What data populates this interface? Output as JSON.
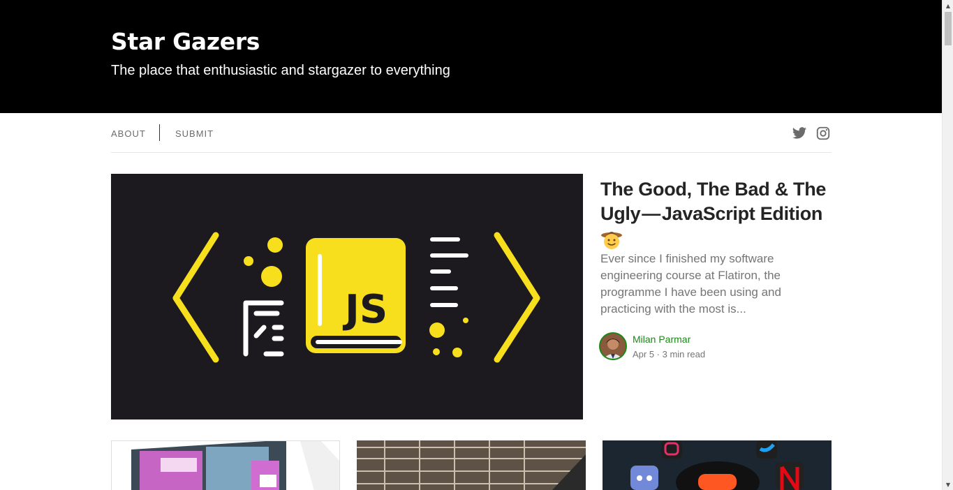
{
  "publication": {
    "title": "Star Gazers",
    "tagline": "The place that enthusiastic and stargazer to everything"
  },
  "nav": {
    "about": "ABOUT",
    "submit": "SUBMIT",
    "social": [
      "twitter-icon",
      "instagram-icon"
    ]
  },
  "featured": {
    "title": "The Good, The Bad & The Ugly — JavaScript Edition",
    "emoji": "cowboy-face-emoji",
    "excerpt": "Ever since I finished my software engineering course at Flatiron, the programme I have been using and practicing with the most is...",
    "author": "Milan Parmar",
    "meta": "Apr 5 · 3 min read",
    "image_text": "JS"
  },
  "colors": {
    "header_bg": "#000000",
    "js_yellow": "#f7df1e",
    "author_green": "#1a8917",
    "text_dark": "#242424",
    "text_muted": "#757575"
  }
}
